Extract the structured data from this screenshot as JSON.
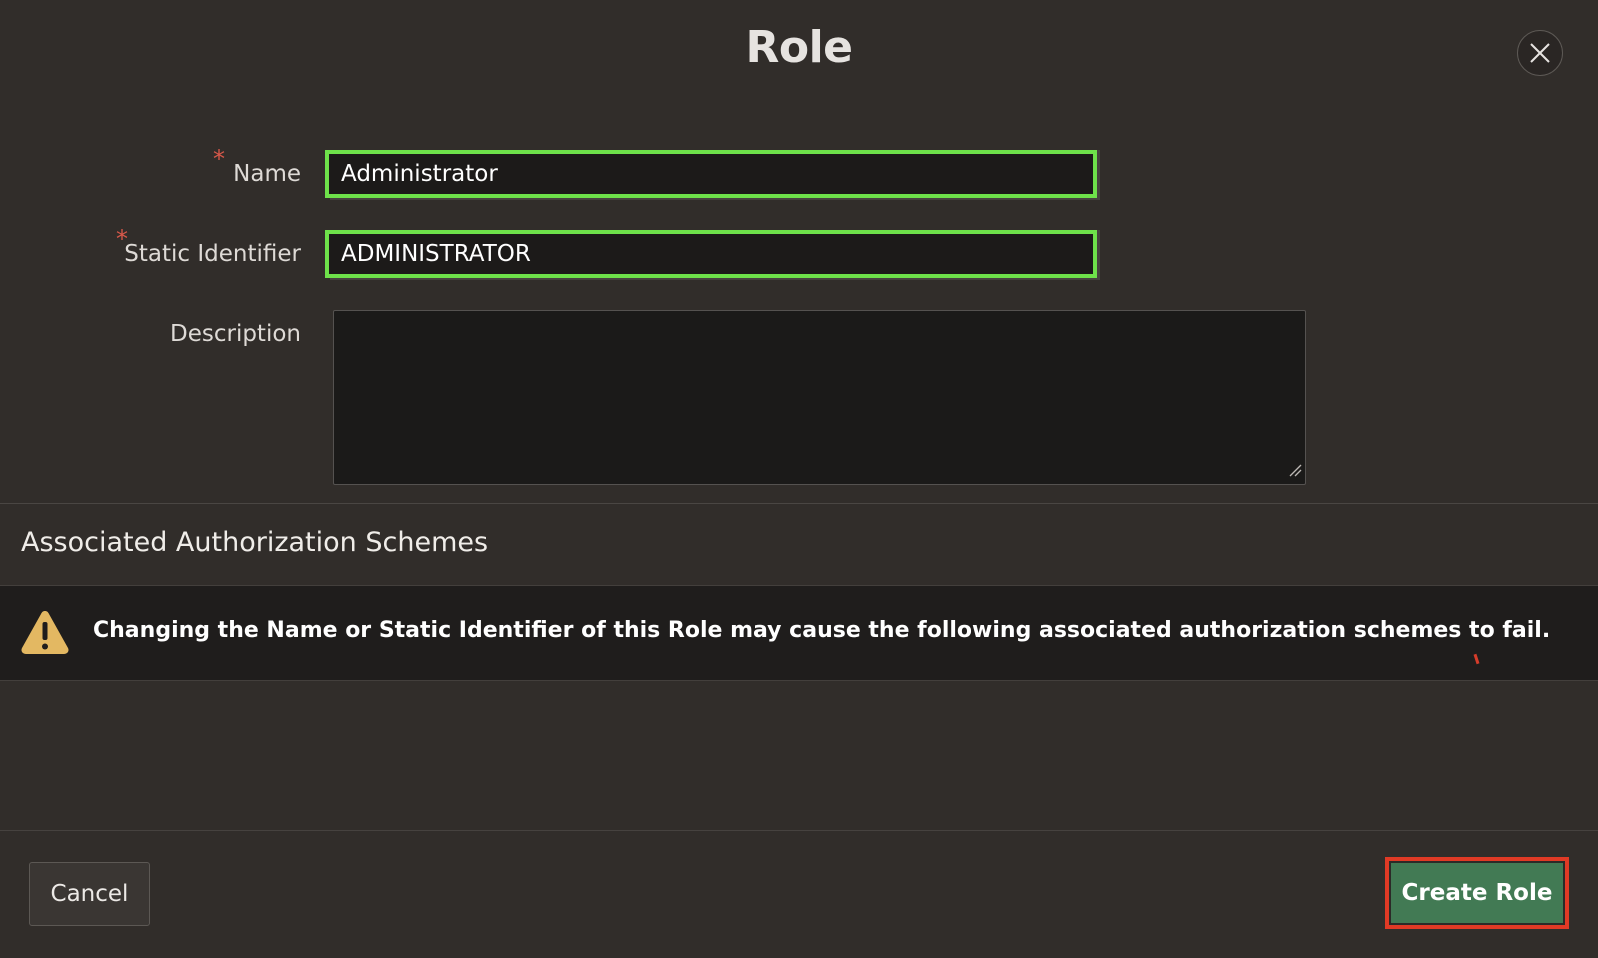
{
  "dialog": {
    "title": "Role",
    "close_icon": "close-icon"
  },
  "form": {
    "name": {
      "label": "Name",
      "required_marker": "*",
      "value": "Administrator"
    },
    "static_identifier": {
      "label": "Static Identifier",
      "required_marker": "*",
      "value": "ADMINISTRATOR"
    },
    "description": {
      "label": "Description",
      "value": ""
    }
  },
  "schemes": {
    "heading": "Associated Authorization Schemes",
    "alert_icon": "warning-icon",
    "alert_text": "Changing the Name or Static Identifier of this Role may cause the following associated authorization schemes to fail."
  },
  "footer": {
    "cancel_label": "Cancel",
    "create_label": "Create Role"
  },
  "colors": {
    "background": "#312d2a",
    "input_focus_border": "#6ee14a",
    "required_marker": "#d8584a",
    "warning": "#e3b862",
    "primary_button": "#427a54",
    "highlight_border": "#e03a25"
  }
}
